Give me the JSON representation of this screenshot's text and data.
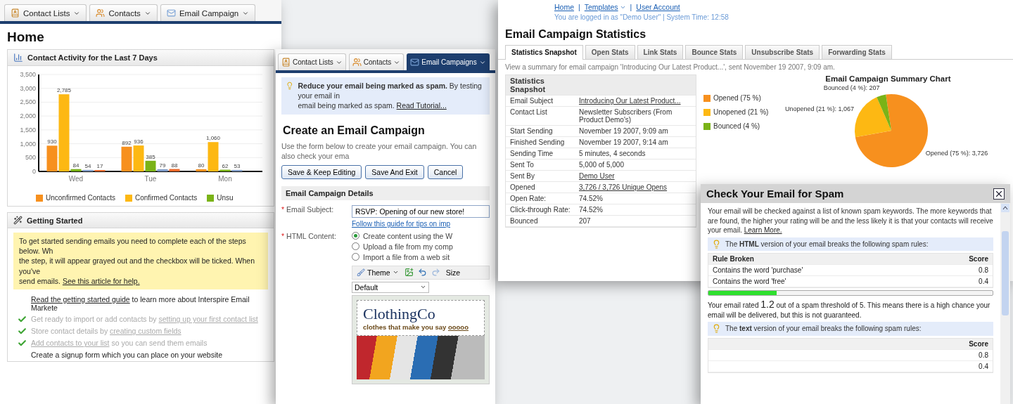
{
  "home": {
    "nav_tabs": [
      {
        "label": "Contact Lists",
        "selected": false
      },
      {
        "label": "Contacts",
        "selected": false
      },
      {
        "label": "Email Campaign",
        "selected": false
      }
    ],
    "title": "Home",
    "activity_panel": {
      "title": "Contact Activity for the Last 7 Days",
      "chart_data": {
        "type": "bar",
        "categories": [
          "Wed",
          "Tue",
          "Mon"
        ],
        "ylim": [
          0,
          3500
        ],
        "yticks": [
          0,
          500,
          {
            "value": 1000,
            "label": "1,000"
          },
          {
            "value": 1500,
            "label": "1,500"
          },
          {
            "value": 2000,
            "label": "2,000"
          },
          {
            "value": 2500,
            "label": "2,500"
          },
          {
            "value": 3000,
            "label": "3,000"
          },
          {
            "value": 3500,
            "label": "3,500"
          }
        ],
        "grid": true,
        "series": [
          {
            "name": "Unconfirmed Contacts",
            "color": "#f7901e",
            "values": [
              930,
              892,
              80
            ],
            "value_labels": [
              "930",
              "892",
              "80"
            ]
          },
          {
            "name": "Confirmed Contacts",
            "color": "#fdb813",
            "values": [
              2785,
              936,
              1060
            ],
            "value_labels": [
              "2,785",
              "936",
              "1,060"
            ]
          },
          {
            "name": "Unsu",
            "color": "#7ab317",
            "values": [
              84,
              385,
              62
            ],
            "value_labels": [
              "84",
              "385",
              "62"
            ]
          },
          {
            "color": "#7f9cc8",
            "values": [
              54,
              79,
              53
            ],
            "value_labels": [
              "54",
              "79",
              "53"
            ]
          },
          {
            "color": "#ee6a2c",
            "values": [
              17,
              88,
              null
            ],
            "value_labels": [
              "17",
              "88",
              null
            ]
          }
        ]
      }
    },
    "getting_started": {
      "title": "Getting Started",
      "notice_lines": [
        "To get started sending emails you need to complete each of the steps below. Wh",
        "the step, it will appear grayed out and the checkbox will be ticked. When you've",
        "send emails."
      ],
      "notice_link": "See this article for help.",
      "intro": {
        "link": "Read the getting started guide",
        "after": "to learn more about Interspire Email Markete"
      },
      "steps": [
        {
          "before": "Get ready to import or add contacts by",
          "link": "setting up your first contact list",
          "done": true
        },
        {
          "before": "Store contact details by",
          "link": "creating custom fields",
          "done": true
        },
        {
          "link": "Add contacts to your list",
          "after": "so you can send them emails",
          "done": true
        },
        {
          "before": "Create a signup form which you can place on your website",
          "done": false
        }
      ]
    }
  },
  "create_campaign": {
    "nav_tabs": [
      {
        "label": "Contact Lists",
        "selected": false
      },
      {
        "label": "Contacts",
        "selected": false
      },
      {
        "label": "Email Campaigns",
        "selected": true
      }
    ],
    "tip_lines": [
      "**Reduce your email being marked as spam.** By testing your email in",
      "email being marked as spam."
    ],
    "tip_link": "Read Tutorial...",
    "title": "Create an Email Campaign",
    "description": "Use the form below to create your email campaign. You can also check your ema",
    "buttons": [
      "Save & Keep Editing",
      "Save And Exit",
      "Cancel"
    ],
    "section_title": "Email Campaign Details",
    "subject": {
      "label": "Email Subject:",
      "required_mark": "*",
      "value": "RSVP: Opening of our new store!",
      "help_link": "Follow this guide for tips on imp"
    },
    "content": {
      "label": "HTML Content:",
      "required_mark": "*",
      "options": [
        {
          "label": "Create content using the W",
          "selected": true
        },
        {
          "label": "Upload a file from my comp",
          "selected": false
        },
        {
          "label": "Import a file from a web sit",
          "selected": false
        }
      ]
    },
    "editor": {
      "theme_label": "Theme",
      "size_label": "Size",
      "format_value": "Default",
      "logo": "ClothingCo",
      "tagline": "clothes that make you say",
      "tagline_mark": "ooooo"
    }
  },
  "statistics": {
    "top_links": [
      {
        "label": "Home",
        "dropdown": false
      },
      {
        "label": "Templates",
        "dropdown": true
      },
      {
        "label": "User Account",
        "dropdown": false
      }
    ],
    "separator": "|",
    "login_status": "You are logged in as \"Demo User\" | System Time: 12:58",
    "title": "Email Campaign Statistics",
    "tabs": [
      {
        "label": "Statistics Snapshot",
        "selected": true
      },
      {
        "label": "Open Stats",
        "selected": false
      },
      {
        "label": "Link Stats",
        "selected": false
      },
      {
        "label": "Bounce Stats",
        "selected": false
      },
      {
        "label": "Unsubscribe Stats",
        "selected": false
      },
      {
        "label": "Forwarding Stats",
        "selected": false
      }
    ],
    "description": "View a summary for email campaign 'Introducing Our Latest Product...', sent November 19 2007, 9:09 am.",
    "table_title": "Statistics Snapshot",
    "rows": [
      {
        "label": "Email Subject",
        "value": "Introducing Our Latest Product...",
        "kind": "link"
      },
      {
        "label": "Contact List",
        "value": "Newsletter Subscribers (From Product Demo's)",
        "kind": "text"
      },
      {
        "label": "Start Sending",
        "value": "November 19 2007, 9:09 am",
        "kind": "text"
      },
      {
        "label": "Finished Sending",
        "value": "November 19 2007, 9:14 am",
        "kind": "text"
      },
      {
        "label": "Sending Time",
        "value": "5 minutes, 4 seconds",
        "kind": "text"
      },
      {
        "label": "Sent To",
        "value": "5,000 of 5,000",
        "kind": "text"
      },
      {
        "label": "Sent By",
        "value": "Demo User",
        "kind": "link"
      },
      {
        "label": "Opened",
        "value": "3,726 / 3,726 Unique Opens",
        "kind": "link"
      },
      {
        "label": "Open Rate:",
        "value": "74.52%",
        "kind": "text"
      },
      {
        "label": "Click-through Rate:",
        "value": "74.52%",
        "kind": "text"
      },
      {
        "label": "Bounced",
        "value": "207",
        "kind": "text"
      }
    ],
    "legend": [
      {
        "label": "Opened (75 %)",
        "color": "#f7901e"
      },
      {
        "label": "Unopened (21 %)",
        "color": "#fdb813"
      },
      {
        "label": "Bounced (4 %)",
        "color": "#7ab317"
      }
    ],
    "chart_data": {
      "type": "pie",
      "title": "Email Campaign Summary Chart",
      "values": [
        3726,
        1067,
        207
      ],
      "value_labels": [
        "Opened (75 %): 3,726",
        "Unopened (21 %): 1,067",
        "Bounced (4 %): 207"
      ]
    }
  },
  "spam_check": {
    "title": "Check Your Email for Spam",
    "intro": "Your email will be checked against a list of known spam keywords. The more keywords that are found, the higher your rating will be and the less likely it is that your contacts will receive your email.",
    "intro_link": "Learn More.",
    "sections": [
      {
        "tip": "The **HTML** version of your email breaks the following spam rules:",
        "rule_header": "Rule Broken",
        "score_header": "Score",
        "rows": [
          {
            "rule": "Contains the word 'purchase'",
            "score": "0.8"
          },
          {
            "rule": "Contains the word 'free'",
            "score": "0.4"
          }
        ],
        "rating": {
          "level": 0.24,
          "text": "Your email rated **1.2** out of a spam threshold of 5. This means there is a high chance your email will be delivered, but this is not guaranteed."
        }
      },
      {
        "tip": "The **text** version of your email breaks the following spam rules:",
        "score_header": "Score",
        "rows": [
          {
            "score": "0.8"
          },
          {
            "score": "0.4"
          }
        ]
      }
    ]
  }
}
